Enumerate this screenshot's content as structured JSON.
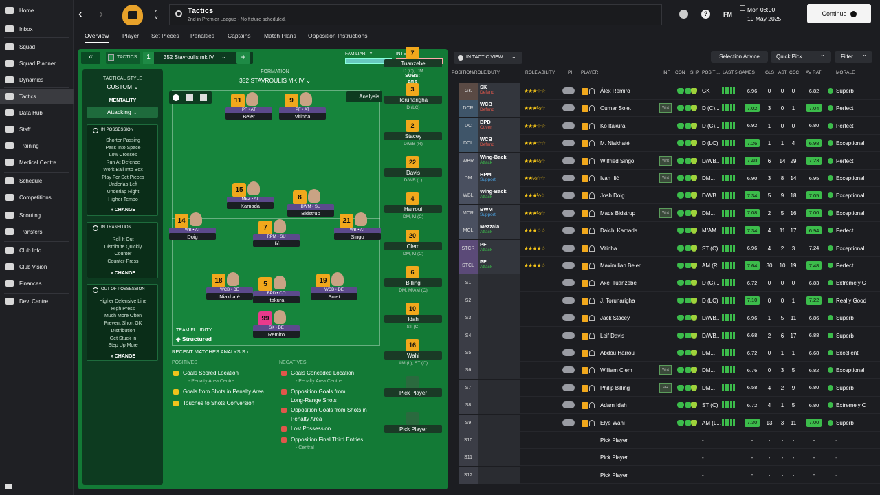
{
  "sidebar": {
    "items": [
      "Home",
      "Inbox",
      "Squad",
      "Squad Planner",
      "Dynamics",
      "Tactics",
      "Data Hub",
      "Staff",
      "Training",
      "Medical Centre",
      "Schedule",
      "Competitions",
      "Scouting",
      "Transfers",
      "Club Info",
      "Club Vision",
      "Finances",
      "Dev. Centre"
    ]
  },
  "header": {
    "title": "Tactics",
    "subtitle": "2nd in Premier League - No fixture scheduled.",
    "date_line1": "Mon 08:00",
    "date_line2": "19 May 2025",
    "continue_label": "Continue",
    "fm_label": "FM"
  },
  "tabs": [
    "Overview",
    "Player",
    "Set Pieces",
    "Penalties",
    "Captains",
    "Match Plans",
    "Opposition Instructions"
  ],
  "tactic": {
    "tactics_label": "TACTICS",
    "slot_number": "1",
    "name": "352 Stavroulis mk IV",
    "familiarity_label": "FAMILIARITY",
    "intensity_label": "INTENSITY",
    "familiarity_value": 0.92,
    "intensity_value": 0.85,
    "tactical_style_label": "TACTICAL STYLE",
    "tactical_style_value": "CUSTOM",
    "mentality_label": "MENTALITY",
    "mentality_value": "Attacking",
    "formation_label": "FORMATION",
    "formation_value": "352 STAVROULIS MK IV",
    "subs_label": "SUBS:",
    "subs_count": "9/15",
    "analysis_label": "Analysis",
    "fluidity_label": "TEAM FLUIDITY",
    "fluidity_value": "Structured",
    "change_label": "CHANGE"
  },
  "in_possession": {
    "title": "IN POSSESSION",
    "items": [
      "Shorter Passing",
      "Pass Into Space",
      "Low Crosses",
      "Run At Defence",
      "Work Ball Into Box",
      "Play For Set Pieces",
      "Underlap Left",
      "Underlap Right",
      "Higher Tempo"
    ]
  },
  "in_transition": {
    "title": "IN TRANSITION",
    "items": [
      "Roll It Out",
      "Distribute Quickly",
      "Counter",
      "Counter-Press"
    ]
  },
  "out_of_possession": {
    "title": "OUT OF POSSESSION",
    "items": [
      "Higher Defensive Line",
      "High Press",
      "Much More Often",
      "Prevent Short GK",
      "Distribution",
      "Get Stuck In",
      "Step Up More"
    ]
  },
  "pitch_players": [
    {
      "num": "11",
      "role": "PF • AT",
      "name": "Beier"
    },
    {
      "num": "9",
      "role": "PF • AT",
      "name": "Vitinha"
    },
    {
      "num": "15",
      "role": "MEZ • AT",
      "name": "Kamada"
    },
    {
      "num": "8",
      "role": "BWM • SU",
      "name": "Bidstrup"
    },
    {
      "num": "14",
      "role": "WB • AT",
      "name": "Doig"
    },
    {
      "num": "7",
      "role": "RPM • SU",
      "name": "Ilić"
    },
    {
      "num": "21",
      "role": "WB • AT",
      "name": "Singo"
    },
    {
      "num": "18",
      "role": "WCB • DE",
      "name": "Niakhaté"
    },
    {
      "num": "5",
      "role": "BPD • CO",
      "name": "Itakura"
    },
    {
      "num": "19",
      "role": "WCB • DE",
      "name": "Solet"
    },
    {
      "num": "99",
      "role": "SK • DE",
      "name": "Remiro"
    }
  ],
  "subs": [
    {
      "num": "7",
      "name": "Tuanzebe",
      "pos": "D (C), DM"
    },
    {
      "num": "3",
      "name": "Torunarigha",
      "pos": "D (LC)"
    },
    {
      "num": "2",
      "name": "Stacey",
      "pos": "D/WB (R)"
    },
    {
      "num": "22",
      "name": "Davis",
      "pos": "D/WB (L)"
    },
    {
      "num": "4",
      "name": "Harroui",
      "pos": "DM, M (C)"
    },
    {
      "num": "20",
      "name": "Clem",
      "pos": "DM, M (C)"
    },
    {
      "num": "6",
      "name": "Billing",
      "pos": "DM, M/AM (C)"
    },
    {
      "num": "10",
      "name": "Idah",
      "pos": "ST (C)"
    },
    {
      "num": "16",
      "name": "Wahi",
      "pos": "AM (L), ST (C)"
    },
    {
      "num": "",
      "name": "Pick Player",
      "pos": ""
    },
    {
      "num": "",
      "name": "Pick Player",
      "pos": ""
    }
  ],
  "analysis": {
    "title": "RECENT MATCHES ANALYSIS",
    "positives_label": "POSITIVES",
    "negatives_label": "NEGATIVES",
    "positives": [
      "Goals Scored Location",
      "- Penalty Area Centre",
      "Goals from Shots in Penalty Area",
      "Touches to Shots Conversion"
    ],
    "negatives": [
      "Goals Conceded Location",
      "- Penalty Area Centre",
      "Opposition Goals from",
      "Long-Range Shots",
      "Opposition Goals from Shots in",
      "Penalty Area",
      "Lost Possession",
      "Opposition Final Third Entries",
      "- Central"
    ]
  },
  "right": {
    "view_label": "IN TACTIC VIEW",
    "selection_advice": "Selection Advice",
    "quick_pick": "Quick Pick",
    "filter": "Filter",
    "headers": [
      "POSITION/ROLE/DUTY",
      "ROLE ABILITY",
      "PI",
      "PLAYER",
      "INF",
      "CON",
      "SHP",
      "POSITI...",
      "LAST 5 GAMES",
      "GLS",
      "AST",
      "CCC",
      "AV RAT",
      "MORALE"
    ]
  },
  "rows": [
    {
      "slot": "GK",
      "role": "SK",
      "duty": "Defend",
      "duty_color": "#e0574b",
      "stars": "★★★☆☆",
      "player": "Álex Remiro",
      "pos": "GK",
      "rat": "6.96",
      "gls": "0",
      "ast": "0",
      "ccc": "0",
      "avrat": "6.82",
      "morale": "Superb",
      "hl": false,
      "wnt": ""
    },
    {
      "slot": "DCR",
      "role": "WCB",
      "duty": "Defend",
      "duty_color": "#e0574b",
      "stars": "★★★½☆",
      "player": "Oumar Solet",
      "pos": "D (C)...",
      "rat": "7.02",
      "gls": "3",
      "ast": "0",
      "ccc": "1",
      "avrat": "7.04",
      "morale": "Perfect",
      "hl": true,
      "wnt": "Wnt"
    },
    {
      "slot": "DC",
      "role": "BPD",
      "duty": "Cover",
      "duty_color": "#e0574b",
      "stars": "★★★☆☆",
      "player": "Ko Itakura",
      "pos": "D (C)...",
      "rat": "6.92",
      "gls": "1",
      "ast": "0",
      "ccc": "0",
      "avrat": "6.80",
      "morale": "Perfect",
      "hl": false,
      "wnt": ""
    },
    {
      "slot": "DCL",
      "role": "WCB",
      "duty": "Defend",
      "duty_color": "#e0574b",
      "stars": "★★★☆☆",
      "player": "M. Niakhaté",
      "pos": "D (LC)",
      "rat": "7.26",
      "gls": "1",
      "ast": "1",
      "ccc": "4",
      "avrat": "6.98",
      "morale": "Exceptional",
      "hl": true,
      "wnt": ""
    },
    {
      "slot": "WBR",
      "role": "Wing-Back",
      "duty": "Attack",
      "duty_color": "#3cbc4b",
      "stars": "★★★½☆",
      "player": "Wilfried Singo",
      "pos": "D/WB...",
      "rat": "7.40",
      "gls": "6",
      "ast": "14",
      "ccc": "29",
      "avrat": "7.23",
      "morale": "Perfect",
      "hl": true,
      "wnt": "Wnt"
    },
    {
      "slot": "DM",
      "role": "RPM",
      "duty": "Support",
      "duty_color": "#4aa0e0",
      "stars": "★★½☆☆",
      "player": "Ivan Ilić",
      "pos": "DM...",
      "rat": "6.90",
      "gls": "3",
      "ast": "8",
      "ccc": "14",
      "avrat": "6.95",
      "morale": "Exceptional",
      "hl": false,
      "wnt": "Wnt"
    },
    {
      "slot": "WBL",
      "role": "Wing-Back",
      "duty": "Attack",
      "duty_color": "#3cbc4b",
      "stars": "★★★½☆",
      "player": "Josh Doig",
      "pos": "D/WB...",
      "rat": "7.34",
      "gls": "5",
      "ast": "9",
      "ccc": "18",
      "avrat": "7.05",
      "morale": "Exceptional",
      "hl": true,
      "wnt": ""
    },
    {
      "slot": "MCR",
      "role": "BWM",
      "duty": "Support",
      "duty_color": "#4aa0e0",
      "stars": "★★★½☆",
      "player": "Mads Bidstrup",
      "pos": "DM...",
      "rat": "7.08",
      "gls": "2",
      "ast": "5",
      "ccc": "16",
      "avrat": "7.00",
      "morale": "Exceptional",
      "hl": true,
      "wnt": "Wnt"
    },
    {
      "slot": "MCL",
      "role": "Mezzala",
      "duty": "Attack",
      "duty_color": "#3cbc4b",
      "stars": "★★★☆☆",
      "player": "Daichi Kamada",
      "pos": "M/AM...",
      "rat": "7.34",
      "gls": "4",
      "ast": "11",
      "ccc": "17",
      "avrat": "6.94",
      "morale": "Perfect",
      "hl": true,
      "wnt": ""
    },
    {
      "slot": "STCR",
      "role": "PF",
      "duty": "Attack",
      "duty_color": "#3cbc4b",
      "stars": "★★★★☆",
      "player": "Vitinha",
      "pos": "ST (C)",
      "rat": "6.96",
      "gls": "4",
      "ast": "2",
      "ccc": "3",
      "avrat": "7.24",
      "morale": "Exceptional",
      "hl": false,
      "wnt": ""
    },
    {
      "slot": "STCL",
      "role": "PF",
      "duty": "Attack",
      "duty_color": "#3cbc4b",
      "stars": "★★★★☆",
      "player": "Maximilian Beier",
      "pos": "AM (R...",
      "rat": "7.64",
      "gls": "30",
      "ast": "10",
      "ccc": "19",
      "avrat": "7.48",
      "morale": "Perfect",
      "hl": true,
      "wnt": ""
    },
    {
      "slot": "S1",
      "role": "",
      "duty": "",
      "duty_color": "",
      "stars": "",
      "player": "Axel Tuanzebe",
      "pos": "D (C)...",
      "rat": "6.72",
      "gls": "0",
      "ast": "0",
      "ccc": "0",
      "avrat": "6.83",
      "morale": "Extremely C",
      "hl": false,
      "wnt": ""
    },
    {
      "slot": "S2",
      "role": "",
      "duty": "",
      "duty_color": "",
      "stars": "",
      "player": "J. Torunarigha",
      "pos": "D (LC)",
      "rat": "7.10",
      "gls": "0",
      "ast": "0",
      "ccc": "1",
      "avrat": "7.22",
      "morale": "Really Good",
      "hl": true,
      "wnt": ""
    },
    {
      "slot": "S3",
      "role": "",
      "duty": "",
      "duty_color": "",
      "stars": "",
      "player": "Jack Stacey",
      "pos": "D/WB...",
      "rat": "6.96",
      "gls": "1",
      "ast": "5",
      "ccc": "11",
      "avrat": "6.86",
      "morale": "Superb",
      "hl": false,
      "wnt": ""
    },
    {
      "slot": "S4",
      "role": "",
      "duty": "",
      "duty_color": "",
      "stars": "",
      "player": "Leif Davis",
      "pos": "D/WB...",
      "rat": "6.68",
      "gls": "2",
      "ast": "6",
      "ccc": "17",
      "avrat": "6.88",
      "morale": "Superb",
      "hl": false,
      "wnt": ""
    },
    {
      "slot": "S5",
      "role": "",
      "duty": "",
      "duty_color": "",
      "stars": "",
      "player": "Abdou Harroui",
      "pos": "DM...",
      "rat": "6.72",
      "gls": "0",
      "ast": "1",
      "ccc": "1",
      "avrat": "6.68",
      "morale": "Excellent",
      "hl": false,
      "wnt": ""
    },
    {
      "slot": "S6",
      "role": "",
      "duty": "",
      "duty_color": "",
      "stars": "",
      "player": "William Clem",
      "pos": "DM...",
      "rat": "6.76",
      "gls": "0",
      "ast": "3",
      "ccc": "5",
      "avrat": "6.82",
      "morale": "Exceptional",
      "hl": false,
      "wnt": "Wnt"
    },
    {
      "slot": "S7",
      "role": "",
      "duty": "",
      "duty_color": "",
      "stars": "",
      "player": "Philip Billing",
      "pos": "DM...",
      "rat": "6.58",
      "gls": "4",
      "ast": "2",
      "ccc": "9",
      "avrat": "6.80",
      "morale": "Superb",
      "hl": false,
      "wnt": "PR"
    },
    {
      "slot": "S8",
      "role": "",
      "duty": "",
      "duty_color": "",
      "stars": "",
      "player": "Adam Idah",
      "pos": "ST (C)",
      "rat": "6.72",
      "gls": "4",
      "ast": "1",
      "ccc": "5",
      "avrat": "6.80",
      "morale": "Extremely C",
      "hl": false,
      "wnt": ""
    },
    {
      "slot": "S9",
      "role": "",
      "duty": "",
      "duty_color": "",
      "stars": "",
      "player": "Elye Wahi",
      "pos": "AM (L...",
      "rat": "7.30",
      "gls": "13",
      "ast": "3",
      "ccc": "11",
      "avrat": "7.00",
      "morale": "Superb",
      "hl": true,
      "wnt": ""
    },
    {
      "slot": "S10",
      "role": "",
      "duty": "",
      "duty_color": "",
      "stars": "",
      "player": "Pick Player",
      "pos": "-",
      "rat": "-",
      "gls": "-",
      "ast": "-",
      "ccc": "-",
      "avrat": "-",
      "morale": "-",
      "hl": false,
      "wnt": "",
      "empty": true
    },
    {
      "slot": "S11",
      "role": "",
      "duty": "",
      "duty_color": "",
      "stars": "",
      "player": "Pick Player",
      "pos": "-",
      "rat": "-",
      "gls": "-",
      "ast": "-",
      "ccc": "-",
      "avrat": "-",
      "morale": "-",
      "hl": false,
      "wnt": "",
      "empty": true
    },
    {
      "slot": "S12",
      "role": "",
      "duty": "",
      "duty_color": "",
      "stars": "",
      "player": "Pick Player",
      "pos": "-",
      "rat": "-",
      "gls": "-",
      "ast": "-",
      "ccc": "-",
      "avrat": "-",
      "morale": "-",
      "hl": false,
      "wnt": "",
      "empty": true
    }
  ]
}
